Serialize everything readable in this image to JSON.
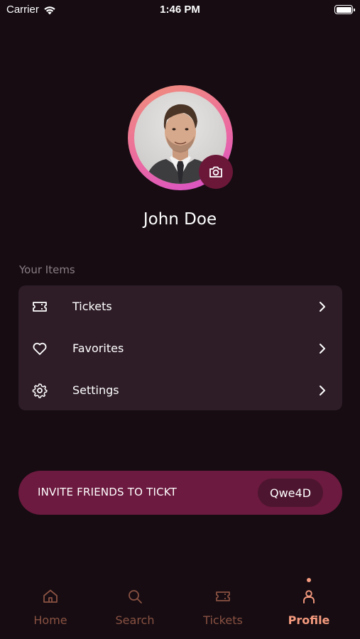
{
  "status_bar": {
    "carrier": "Carrier",
    "time": "1:46 PM"
  },
  "profile": {
    "name": "John Doe"
  },
  "items_section": {
    "label": "Your Items",
    "items": [
      {
        "label": "Tickets",
        "icon": "ticket-icon"
      },
      {
        "label": "Favorites",
        "icon": "heart-icon"
      },
      {
        "label": "Settings",
        "icon": "gear-icon"
      }
    ]
  },
  "invite": {
    "text": "INVITE FRIENDS TO TICKT",
    "code": "Qwe4D"
  },
  "tab_bar": {
    "tabs": [
      {
        "label": "Home",
        "icon": "home-icon"
      },
      {
        "label": "Search",
        "icon": "search-icon"
      },
      {
        "label": "Tickets",
        "icon": "ticket-icon"
      },
      {
        "label": "Profile",
        "icon": "person-icon",
        "active": true
      }
    ]
  },
  "colors": {
    "background": "#160c12",
    "card": "#2e1d27",
    "accent": "#6c1a3f",
    "tab_active": "#f49a7e",
    "tab_inactive": "#8a5242"
  }
}
